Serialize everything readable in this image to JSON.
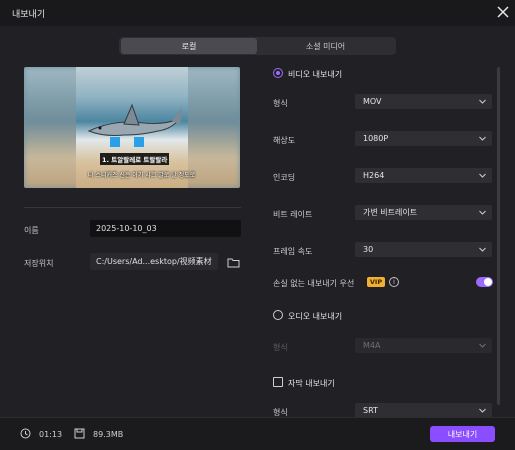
{
  "window": {
    "title": "내보내기"
  },
  "tabs": [
    {
      "label": "로컬"
    },
    {
      "label": "소셜 미디어"
    }
  ],
  "preview": {
    "caption1": "1. 트알랄레로 트랄랄라",
    "caption2": "나 스니커즈 신은 아기 샤크 발로 날 정도로"
  },
  "left": {
    "name_label": "이름",
    "name_value": "2025-10-10_03",
    "path_label": "저장위치",
    "path_value": "C:/Users/Ad...esktop/视频素材"
  },
  "video": {
    "label": "비디오 내보내기",
    "fields": [
      {
        "label": "형식",
        "value": "MOV"
      },
      {
        "label": "해상도",
        "value": "1080P"
      },
      {
        "label": "인코딩",
        "value": "H264"
      },
      {
        "label": "비트 레이트",
        "value": "가변 비트레이트"
      },
      {
        "label": "프레임 속도",
        "value": "30"
      }
    ],
    "lossless_label": "손실 없는 내보내기 우선",
    "vip": "VIP",
    "info": "i"
  },
  "audio": {
    "label": "오디오 내보내기",
    "format_label": "형식",
    "format_value": "M4A"
  },
  "subtitle": {
    "label": "자막 내보내기",
    "format_label": "형식",
    "format_value": "SRT"
  },
  "footer": {
    "duration": "01:13",
    "size": "89.3MB",
    "export_label": "내보내기"
  },
  "colors": {
    "accent": "#8a4dff",
    "vip": "#f0b030",
    "bg": "#212125"
  }
}
